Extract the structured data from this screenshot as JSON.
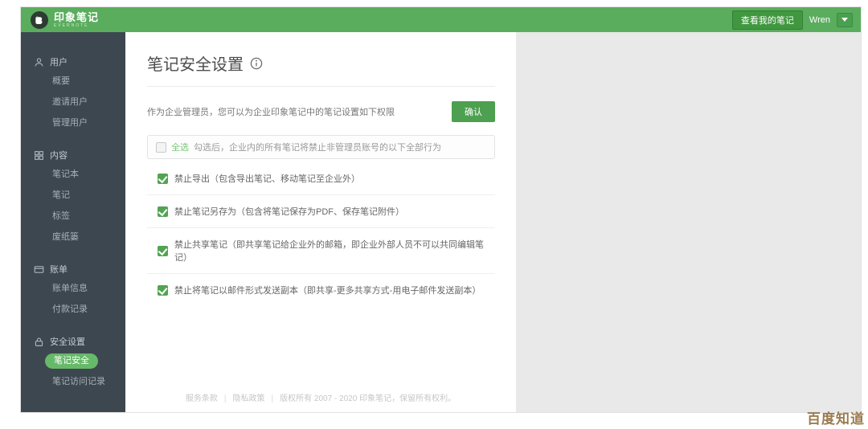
{
  "header": {
    "brand": "印象笔记",
    "brand_sub": "EVERNOTE",
    "view_notes_button": "查看我的笔记",
    "username": "Wren"
  },
  "sidebar": {
    "sections": [
      {
        "label": "用户",
        "icon": "user-icon",
        "items": [
          "概要",
          "邀请用户",
          "管理用户"
        ]
      },
      {
        "label": "内容",
        "icon": "content-icon",
        "items": [
          "笔记本",
          "笔记",
          "标签",
          "废纸篓"
        ]
      },
      {
        "label": "账单",
        "icon": "billing-icon",
        "items": [
          "账单信息",
          "付款记录"
        ]
      },
      {
        "label": "安全设置",
        "icon": "lock-icon",
        "items": [
          "笔记安全",
          "笔记访问记录"
        ],
        "active_item": "笔记安全"
      }
    ]
  },
  "main": {
    "title": "笔记安全设置",
    "description": "作为企业管理员，您可以为企业印象笔记中的笔记设置如下权限",
    "confirm_button": "确认",
    "select_all": {
      "label": "全选",
      "checked": false,
      "hint": "勾选后，企业内的所有笔记将禁止非管理员账号的以下全部行为"
    },
    "permissions": [
      {
        "label": "禁止导出（包含导出笔记、移动笔记至企业外）",
        "checked": true
      },
      {
        "label": "禁止笔记另存为（包含将笔记保存为PDF、保存笔记附件）",
        "checked": true
      },
      {
        "label": "禁止共享笔记（即共享笔记给企业外的邮箱，即企业外部人员不可以共同编辑笔记）",
        "checked": true
      },
      {
        "label": "禁止将笔记以邮件形式发送副本（即共享-更多共享方式-用电子邮件发送副本）",
        "checked": true
      }
    ],
    "footer": {
      "link1": "服务条款",
      "link2": "隐私政策",
      "separator": "|",
      "copyright": "版权所有 2007 - 2020 印象笔记，保留所有权利。"
    }
  },
  "watermark": "百度知道",
  "colors": {
    "header_green": "#5bad5e",
    "sidebar_dark": "#3d474f",
    "accent_green": "#52a452",
    "active_pill_green": "#67b96a",
    "confirm_green": "#4da050",
    "watermark_brown": "#9b7b50"
  }
}
